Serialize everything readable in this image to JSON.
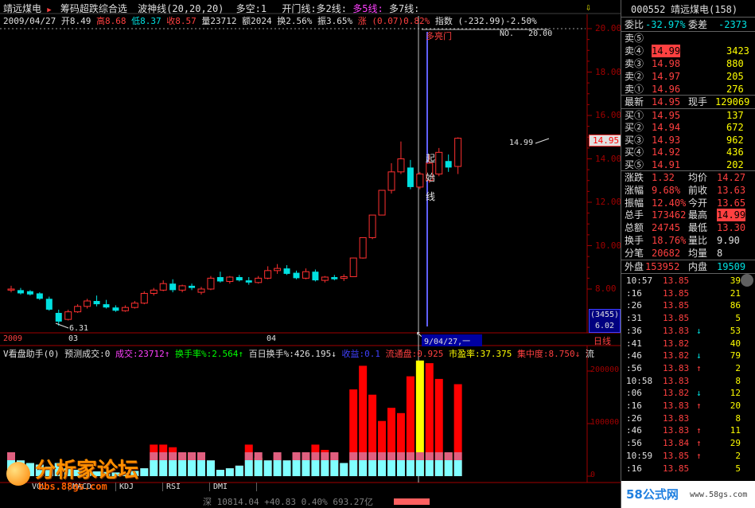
{
  "window_title": "靖远煤电",
  "header": {
    "stock_name": "靖远煤电",
    "indicator_name": "筹码超跌综合选",
    "wave_label": "波神线(20,20,20)",
    "longshort": "多空:1",
    "open_gate": "开门线:多2线:",
    "many5": "多5线:",
    "many7": "多7线:"
  },
  "quote_line": {
    "date": "2009/04/27",
    "open": "开8.49",
    "high": "高8.68",
    "low": "低8.37",
    "close": "收8.57",
    "vol": "量23712",
    "amount": "额2024",
    "turnover": "换2.56%",
    "amplitude": "振3.65%",
    "change": "涨 (0.07)0.82%",
    "index": "指数 (-232.99)-2.50%"
  },
  "chart_text": {
    "dkm": "多亮门",
    "no_label": "NO.   20.00",
    "start_line": [
      "起",
      "始",
      "线"
    ],
    "peak_label": "14.99",
    "low_label": "6.31",
    "cursor_date": "9/04/27,一",
    "price_tag": "14.95",
    "vol_box_top": "(3455)",
    "vol_box_bottom": "6.02",
    "x_labels": [
      "2009",
      "03",
      "04"
    ],
    "period_label": "日线"
  },
  "price_axis": [
    "20.00",
    "18.00",
    "16.00",
    "14.00",
    "12.00",
    "10.00",
    "8.00"
  ],
  "volume_axis": [
    "200000",
    "100000",
    "0"
  ],
  "lower_header": {
    "name": "V看盘助手(0)",
    "forecast": "预测成交:0",
    "vol": "成交:23712↑",
    "turnover": "换手率%:2.564↑",
    "hundred": "百日换手%:426.195↓",
    "earnings": "收益:0.1",
    "float": "流通盘:0.925",
    "pe": "市盈率:37.375",
    "conc": "集中度:8.750↓",
    "tail": "流"
  },
  "tabs": [
    "VOL",
    "MACD",
    "KDJ",
    "RSI",
    "DMI"
  ],
  "status": {
    "text": "深 10814.04 +40.83 0.40% 693.27亿"
  },
  "watermark": {
    "main": "分析家论坛",
    "sub": "bbs.88gs.com",
    "corner": "58公式网",
    "corner_url": "www.58gs.com"
  },
  "quote_panel": {
    "code": "000552",
    "name": "靖远煤电(158)",
    "weibi_label": "委比",
    "weibi": "-32.97%",
    "weicha_label": "委差",
    "weicha": "-2373",
    "sell": [
      {
        "label": "卖⑤",
        "price": "",
        "vol": ""
      },
      {
        "label": "卖④",
        "price": "14.99",
        "vol": "3423"
      },
      {
        "label": "卖③",
        "price": "14.98",
        "vol": "880"
      },
      {
        "label": "卖②",
        "price": "14.97",
        "vol": "205"
      },
      {
        "label": "卖①",
        "price": "14.96",
        "vol": "276"
      }
    ],
    "latest_label": "最新",
    "latest": "14.95",
    "xianshou_label": "现手",
    "xianshou": "129069",
    "buy": [
      {
        "label": "买①",
        "price": "14.95",
        "vol": "137"
      },
      {
        "label": "买②",
        "price": "14.94",
        "vol": "672"
      },
      {
        "label": "买③",
        "price": "14.93",
        "vol": "962"
      },
      {
        "label": "买④",
        "price": "14.92",
        "vol": "436"
      },
      {
        "label": "买⑤",
        "price": "14.91",
        "vol": "202"
      }
    ],
    "stats": [
      {
        "l1": "涨跌",
        "v1": "1.32",
        "l2": "均价",
        "v2": "14.27"
      },
      {
        "l1": "涨幅",
        "v1": "9.68%",
        "l2": "前收",
        "v2": "13.63"
      },
      {
        "l1": "振幅",
        "v1": "12.40%",
        "l2": "今开",
        "v2": "13.65"
      },
      {
        "l1": "总手",
        "v1": "173462",
        "l2": "最高",
        "v2": "14.99"
      },
      {
        "l1": "总额",
        "v1": "24745",
        "l2": "最低",
        "v2": "13.30"
      },
      {
        "l1": "换手",
        "v1": "18.76%",
        "l2": "量比",
        "v2": "9.90"
      },
      {
        "l1": "分笔",
        "v1": "20682",
        "l2": "均量",
        "v2": "8"
      }
    ],
    "outer_label": "外盘",
    "outer": "153952",
    "inner_label": "内盘",
    "inner": "19509"
  },
  "ticks": [
    {
      "time": "10:57",
      "price": "13.85",
      "arrow": "",
      "vol": "39"
    },
    {
      "time": ":16",
      "price": "13.85",
      "arrow": "",
      "vol": "21"
    },
    {
      "time": ":26",
      "price": "13.85",
      "arrow": "",
      "vol": "86"
    },
    {
      "time": ":31",
      "price": "13.85",
      "arrow": "",
      "vol": "5"
    },
    {
      "time": ":36",
      "price": "13.83",
      "arrow": "↓",
      "vol": "53"
    },
    {
      "time": ":41",
      "price": "13.82",
      "arrow": "",
      "vol": "40"
    },
    {
      "time": ":46",
      "price": "13.82",
      "arrow": "↓",
      "vol": "79"
    },
    {
      "time": ":56",
      "price": "13.83",
      "arrow": "↑",
      "vol": "2"
    },
    {
      "time": "10:58",
      "price": "13.83",
      "arrow": "",
      "vol": "8"
    },
    {
      "time": ":06",
      "price": "13.82",
      "arrow": "↓",
      "vol": "12"
    },
    {
      "time": ":16",
      "price": "13.83",
      "arrow": "↑",
      "vol": "20"
    },
    {
      "time": ":26",
      "price": "13.83",
      "arrow": "",
      "vol": "8"
    },
    {
      "time": ":46",
      "price": "13.83",
      "arrow": "↑",
      "vol": "11"
    },
    {
      "time": ":56",
      "price": "13.84",
      "arrow": "↑",
      "vol": "29"
    },
    {
      "time": "10:59",
      "price": "13.85",
      "arrow": "↑",
      "vol": "2"
    },
    {
      "time": ":16",
      "price": "13.85",
      "arrow": "",
      "vol": "5"
    }
  ],
  "candles": [
    {
      "o": 7.95,
      "h": 8.15,
      "l": 7.85,
      "c": 8.0
    },
    {
      "o": 7.95,
      "h": 8.05,
      "l": 7.75,
      "c": 7.8
    },
    {
      "o": 7.9,
      "h": 7.95,
      "l": 7.7,
      "c": 7.75
    },
    {
      "o": 7.8,
      "h": 7.85,
      "l": 7.5,
      "c": 7.55
    },
    {
      "o": 7.55,
      "h": 7.65,
      "l": 7.0,
      "c": 7.05
    },
    {
      "o": 6.9,
      "h": 7.05,
      "l": 6.31,
      "c": 6.5
    },
    {
      "o": 6.6,
      "h": 7.05,
      "l": 6.55,
      "c": 6.95
    },
    {
      "o": 6.95,
      "h": 7.3,
      "l": 6.9,
      "c": 7.2
    },
    {
      "o": 7.2,
      "h": 7.55,
      "l": 7.1,
      "c": 7.45
    },
    {
      "o": 7.45,
      "h": 7.7,
      "l": 7.2,
      "c": 7.3
    },
    {
      "o": 7.3,
      "h": 7.5,
      "l": 7.1,
      "c": 7.15
    },
    {
      "o": 7.15,
      "h": 7.25,
      "l": 6.95,
      "c": 7.0
    },
    {
      "o": 7.0,
      "h": 7.25,
      "l": 6.95,
      "c": 7.15
    },
    {
      "o": 7.15,
      "h": 7.45,
      "l": 7.1,
      "c": 7.35
    },
    {
      "o": 7.35,
      "h": 7.9,
      "l": 7.3,
      "c": 7.8
    },
    {
      "o": 7.8,
      "h": 8.05,
      "l": 7.7,
      "c": 7.95
    },
    {
      "o": 7.95,
      "h": 8.4,
      "l": 7.9,
      "c": 8.25
    },
    {
      "o": 8.25,
      "h": 8.45,
      "l": 7.85,
      "c": 7.95
    },
    {
      "o": 7.95,
      "h": 8.2,
      "l": 7.85,
      "c": 8.15
    },
    {
      "o": 8.15,
      "h": 8.25,
      "l": 7.95,
      "c": 8.05
    },
    {
      "o": 7.85,
      "h": 8.1,
      "l": 7.75,
      "c": 8.0
    },
    {
      "o": 8.0,
      "h": 8.6,
      "l": 7.95,
      "c": 8.5
    },
    {
      "o": 8.55,
      "h": 8.8,
      "l": 8.3,
      "c": 8.35
    },
    {
      "o": 8.35,
      "h": 8.6,
      "l": 8.25,
      "c": 8.55
    },
    {
      "o": 8.55,
      "h": 8.65,
      "l": 8.35,
      "c": 8.4
    },
    {
      "o": 8.4,
      "h": 8.55,
      "l": 8.2,
      "c": 8.3
    },
    {
      "o": 8.3,
      "h": 8.6,
      "l": 8.25,
      "c": 8.5
    },
    {
      "o": 8.5,
      "h": 9.05,
      "l": 8.45,
      "c": 8.85
    },
    {
      "o": 8.85,
      "h": 9.15,
      "l": 8.7,
      "c": 8.95
    },
    {
      "o": 8.95,
      "h": 9.1,
      "l": 8.65,
      "c": 8.7
    },
    {
      "o": 8.75,
      "h": 8.85,
      "l": 8.45,
      "c": 8.5
    },
    {
      "o": 8.5,
      "h": 8.95,
      "l": 8.45,
      "c": 8.8
    },
    {
      "o": 8.8,
      "h": 8.9,
      "l": 8.35,
      "c": 8.4
    },
    {
      "o": 8.4,
      "h": 8.6,
      "l": 8.3,
      "c": 8.55
    },
    {
      "o": 8.55,
      "h": 8.65,
      "l": 8.4,
      "c": 8.45
    },
    {
      "o": 8.49,
      "h": 8.68,
      "l": 8.37,
      "c": 8.57
    },
    {
      "o": 8.57,
      "h": 9.45,
      "l": 8.57,
      "c": 9.43
    },
    {
      "o": 9.43,
      "h": 10.37,
      "l": 9.4,
      "c": 10.37
    },
    {
      "o": 10.37,
      "h": 11.41,
      "l": 10.3,
      "c": 11.41
    },
    {
      "o": 11.41,
      "h": 12.55,
      "l": 11.4,
      "c": 12.55
    },
    {
      "o": 12.55,
      "h": 13.8,
      "l": 12.4,
      "c": 13.4
    },
    {
      "o": 13.4,
      "h": 14.8,
      "l": 13.3,
      "c": 14.0
    },
    {
      "o": 13.6,
      "h": 13.95,
      "l": 12.6,
      "c": 12.7
    },
    {
      "o": 12.7,
      "h": 13.4,
      "l": 12.6,
      "c": 13.3
    },
    {
      "o": 13.0,
      "h": 14.2,
      "l": 12.9,
      "c": 13.8
    },
    {
      "o": 13.3,
      "h": 14.5,
      "l": 13.2,
      "c": 14.3
    },
    {
      "o": 13.9,
      "h": 14.2,
      "l": 13.4,
      "c": 13.6
    },
    {
      "o": 13.65,
      "h": 14.99,
      "l": 13.3,
      "c": 14.95
    }
  ],
  "volumes": [
    {
      "v": 40000,
      "c": "red"
    },
    {
      "v": 30000,
      "c": "red"
    },
    {
      "v": 25000,
      "c": "yellow"
    },
    {
      "v": 22000,
      "c": "red"
    },
    {
      "v": 18000,
      "c": "red"
    },
    {
      "v": 25000,
      "c": "red"
    },
    {
      "v": 15000,
      "c": "red"
    },
    {
      "v": 12000,
      "c": "red"
    },
    {
      "v": 10000,
      "c": "red"
    },
    {
      "v": 9000,
      "c": "red"
    },
    {
      "v": 8000,
      "c": "red"
    },
    {
      "v": 7000,
      "c": "red"
    },
    {
      "v": 6000,
      "c": "red"
    },
    {
      "v": 10000,
      "c": "red"
    },
    {
      "v": 15000,
      "c": "red"
    },
    {
      "v": 60000,
      "c": "red"
    },
    {
      "v": 60000,
      "c": "red"
    },
    {
      "v": 55000,
      "c": "red"
    },
    {
      "v": 45000,
      "c": "yellow"
    },
    {
      "v": 45000,
      "c": "red"
    },
    {
      "v": 40000,
      "c": "red"
    },
    {
      "v": 30000,
      "c": "red"
    },
    {
      "v": 12000,
      "c": "red"
    },
    {
      "v": 15000,
      "c": "red"
    },
    {
      "v": 20000,
      "c": "red"
    },
    {
      "v": 60000,
      "c": "red"
    },
    {
      "v": 35000,
      "c": "yellow"
    },
    {
      "v": 30000,
      "c": "red"
    },
    {
      "v": 40000,
      "c": "red"
    },
    {
      "v": 30000,
      "c": "red"
    },
    {
      "v": 40000,
      "c": "red"
    },
    {
      "v": 35000,
      "c": "red"
    },
    {
      "v": 60000,
      "c": "red"
    },
    {
      "v": 50000,
      "c": "red"
    },
    {
      "v": 45000,
      "c": "red"
    },
    {
      "v": 25000,
      "c": "red"
    },
    {
      "v": 165000,
      "c": "red"
    },
    {
      "v": 210000,
      "c": "red"
    },
    {
      "v": 155000,
      "c": "red"
    },
    {
      "v": 105000,
      "c": "red"
    },
    {
      "v": 130000,
      "c": "red"
    },
    {
      "v": 120000,
      "c": "red"
    },
    {
      "v": 190000,
      "c": "red"
    },
    {
      "v": 220000,
      "c": "yellow"
    },
    {
      "v": 215000,
      "c": "red"
    },
    {
      "v": 185000,
      "c": "red"
    },
    {
      "v": 45000,
      "c": "yellow"
    },
    {
      "v": 175000,
      "c": "red"
    }
  ]
}
